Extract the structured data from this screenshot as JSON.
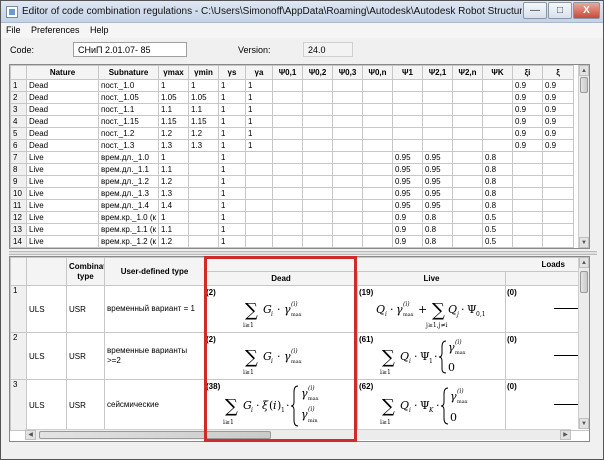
{
  "window": {
    "title": "Editor of code combination regulations - C:\\Users\\Simonoff\\AppData\\Roaming\\Autodesk\\Autodesk Robot Structural Analys...",
    "minimize": "—",
    "maximize": "□",
    "close": "X"
  },
  "menu": [
    "File",
    "Preferences",
    "Help"
  ],
  "form": {
    "code_label": "Code:",
    "code_value": "СНиП 2.01.07- 85",
    "version_label": "Version:",
    "version_value": "24.0"
  },
  "table1": {
    "headers": [
      "",
      "Nature",
      "Subnature",
      "γmax",
      "γmin",
      "γs",
      "γa",
      "Ψ0,1",
      "Ψ0,2",
      "Ψ0,3",
      "Ψ0,n",
      "Ψ1",
      "Ψ2,1",
      "Ψ2,n",
      "ΨK",
      "ξi",
      "ξ"
    ],
    "rows": [
      [
        "1",
        "Dead",
        "пост._1.0",
        "1",
        "1",
        "1",
        "1",
        "",
        "",
        "",
        "",
        "",
        "",
        "",
        "",
        "0.9",
        "0.9"
      ],
      [
        "2",
        "Dead",
        "пост._1.05",
        "1.05",
        "1.05",
        "1",
        "1",
        "",
        "",
        "",
        "",
        "",
        "",
        "",
        "",
        "0.9",
        "0.9"
      ],
      [
        "3",
        "Dead",
        "пост._1.1",
        "1.1",
        "1.1",
        "1",
        "1",
        "",
        "",
        "",
        "",
        "",
        "",
        "",
        "",
        "0.9",
        "0.9"
      ],
      [
        "4",
        "Dead",
        "пост._1.15",
        "1.15",
        "1.15",
        "1",
        "1",
        "",
        "",
        "",
        "",
        "",
        "",
        "",
        "",
        "0.9",
        "0.9"
      ],
      [
        "5",
        "Dead",
        "пост._1.2",
        "1.2",
        "1.2",
        "1",
        "1",
        "",
        "",
        "",
        "",
        "",
        "",
        "",
        "",
        "0.9",
        "0.9"
      ],
      [
        "6",
        "Dead",
        "пост._1.3",
        "1.3",
        "1.3",
        "1",
        "1",
        "",
        "",
        "",
        "",
        "",
        "",
        "",
        "",
        "0.9",
        "0.9"
      ],
      [
        "7",
        "Live",
        "врем.дл._1.0",
        "1",
        "",
        "1",
        "",
        "",
        "",
        "",
        "",
        "0.95",
        "0.95",
        "",
        "0.8",
        "",
        ""
      ],
      [
        "8",
        "Live",
        "врем.дл._1.1",
        "1.1",
        "",
        "1",
        "",
        "",
        "",
        "",
        "",
        "0.95",
        "0.95",
        "",
        "0.8",
        "",
        ""
      ],
      [
        "9",
        "Live",
        "врем.дл._1.2",
        "1.2",
        "",
        "1",
        "",
        "",
        "",
        "",
        "",
        "0.95",
        "0.95",
        "",
        "0.8",
        "",
        ""
      ],
      [
        "10",
        "Live",
        "врем.дл._1.3",
        "1.3",
        "",
        "1",
        "",
        "",
        "",
        "",
        "",
        "0.95",
        "0.95",
        "",
        "0.8",
        "",
        ""
      ],
      [
        "11",
        "Live",
        "врем.дл._1.4",
        "1.4",
        "",
        "1",
        "",
        "",
        "",
        "",
        "",
        "0.95",
        "0.95",
        "",
        "0.8",
        "",
        ""
      ],
      [
        "12",
        "Live",
        "врем.кр._1.0 (к",
        "1",
        "",
        "1",
        "",
        "",
        "",
        "",
        "",
        "0.9",
        "0.8",
        "",
        "0.5",
        "",
        ""
      ],
      [
        "13",
        "Live",
        "врем.кр._1.1 (к",
        "1.1",
        "",
        "1",
        "",
        "",
        "",
        "",
        "",
        "0.9",
        "0.8",
        "",
        "0.5",
        "",
        ""
      ],
      [
        "14",
        "Live",
        "врем.кр._1.2 (к",
        "1.2",
        "",
        "1",
        "",
        "",
        "",
        "",
        "",
        "0.9",
        "0.8",
        "",
        "0.5",
        "",
        ""
      ],
      [
        "15",
        "Live",
        "врем.кр._1.3 (к",
        "1.3",
        "",
        "1",
        "",
        "",
        "",
        "",
        "",
        "0.9",
        "0.8",
        "",
        "0.5",
        "",
        ""
      ]
    ]
  },
  "table2": {
    "col_combination": "Combination type",
    "col_user": "User-defined type",
    "loads_group": "Loads",
    "col_dead": "Dead",
    "col_live": "Live",
    "col_acc": "Ac",
    "rows": [
      {
        "num": "1",
        "type": "ULS",
        "comb": "USR",
        "user": "временный вариант = 1",
        "dead_count": "(2)",
        "live_count": "(19)",
        "acc_count": "(0)"
      },
      {
        "num": "2",
        "type": "ULS",
        "comb": "USR",
        "user": "временные варианты >=2",
        "dead_count": "(2)",
        "live_count": "(61)",
        "acc_count": "(0)"
      },
      {
        "num": "3",
        "type": "ULS",
        "comb": "USR",
        "user": "сейсмические",
        "dead_count": "(38)",
        "live_count": "(62)",
        "acc_count": "(0)"
      }
    ]
  },
  "colors": {
    "highlight": "#d02b2b",
    "title_bar": "#c3d3e6",
    "close_button": "#c8493a"
  }
}
